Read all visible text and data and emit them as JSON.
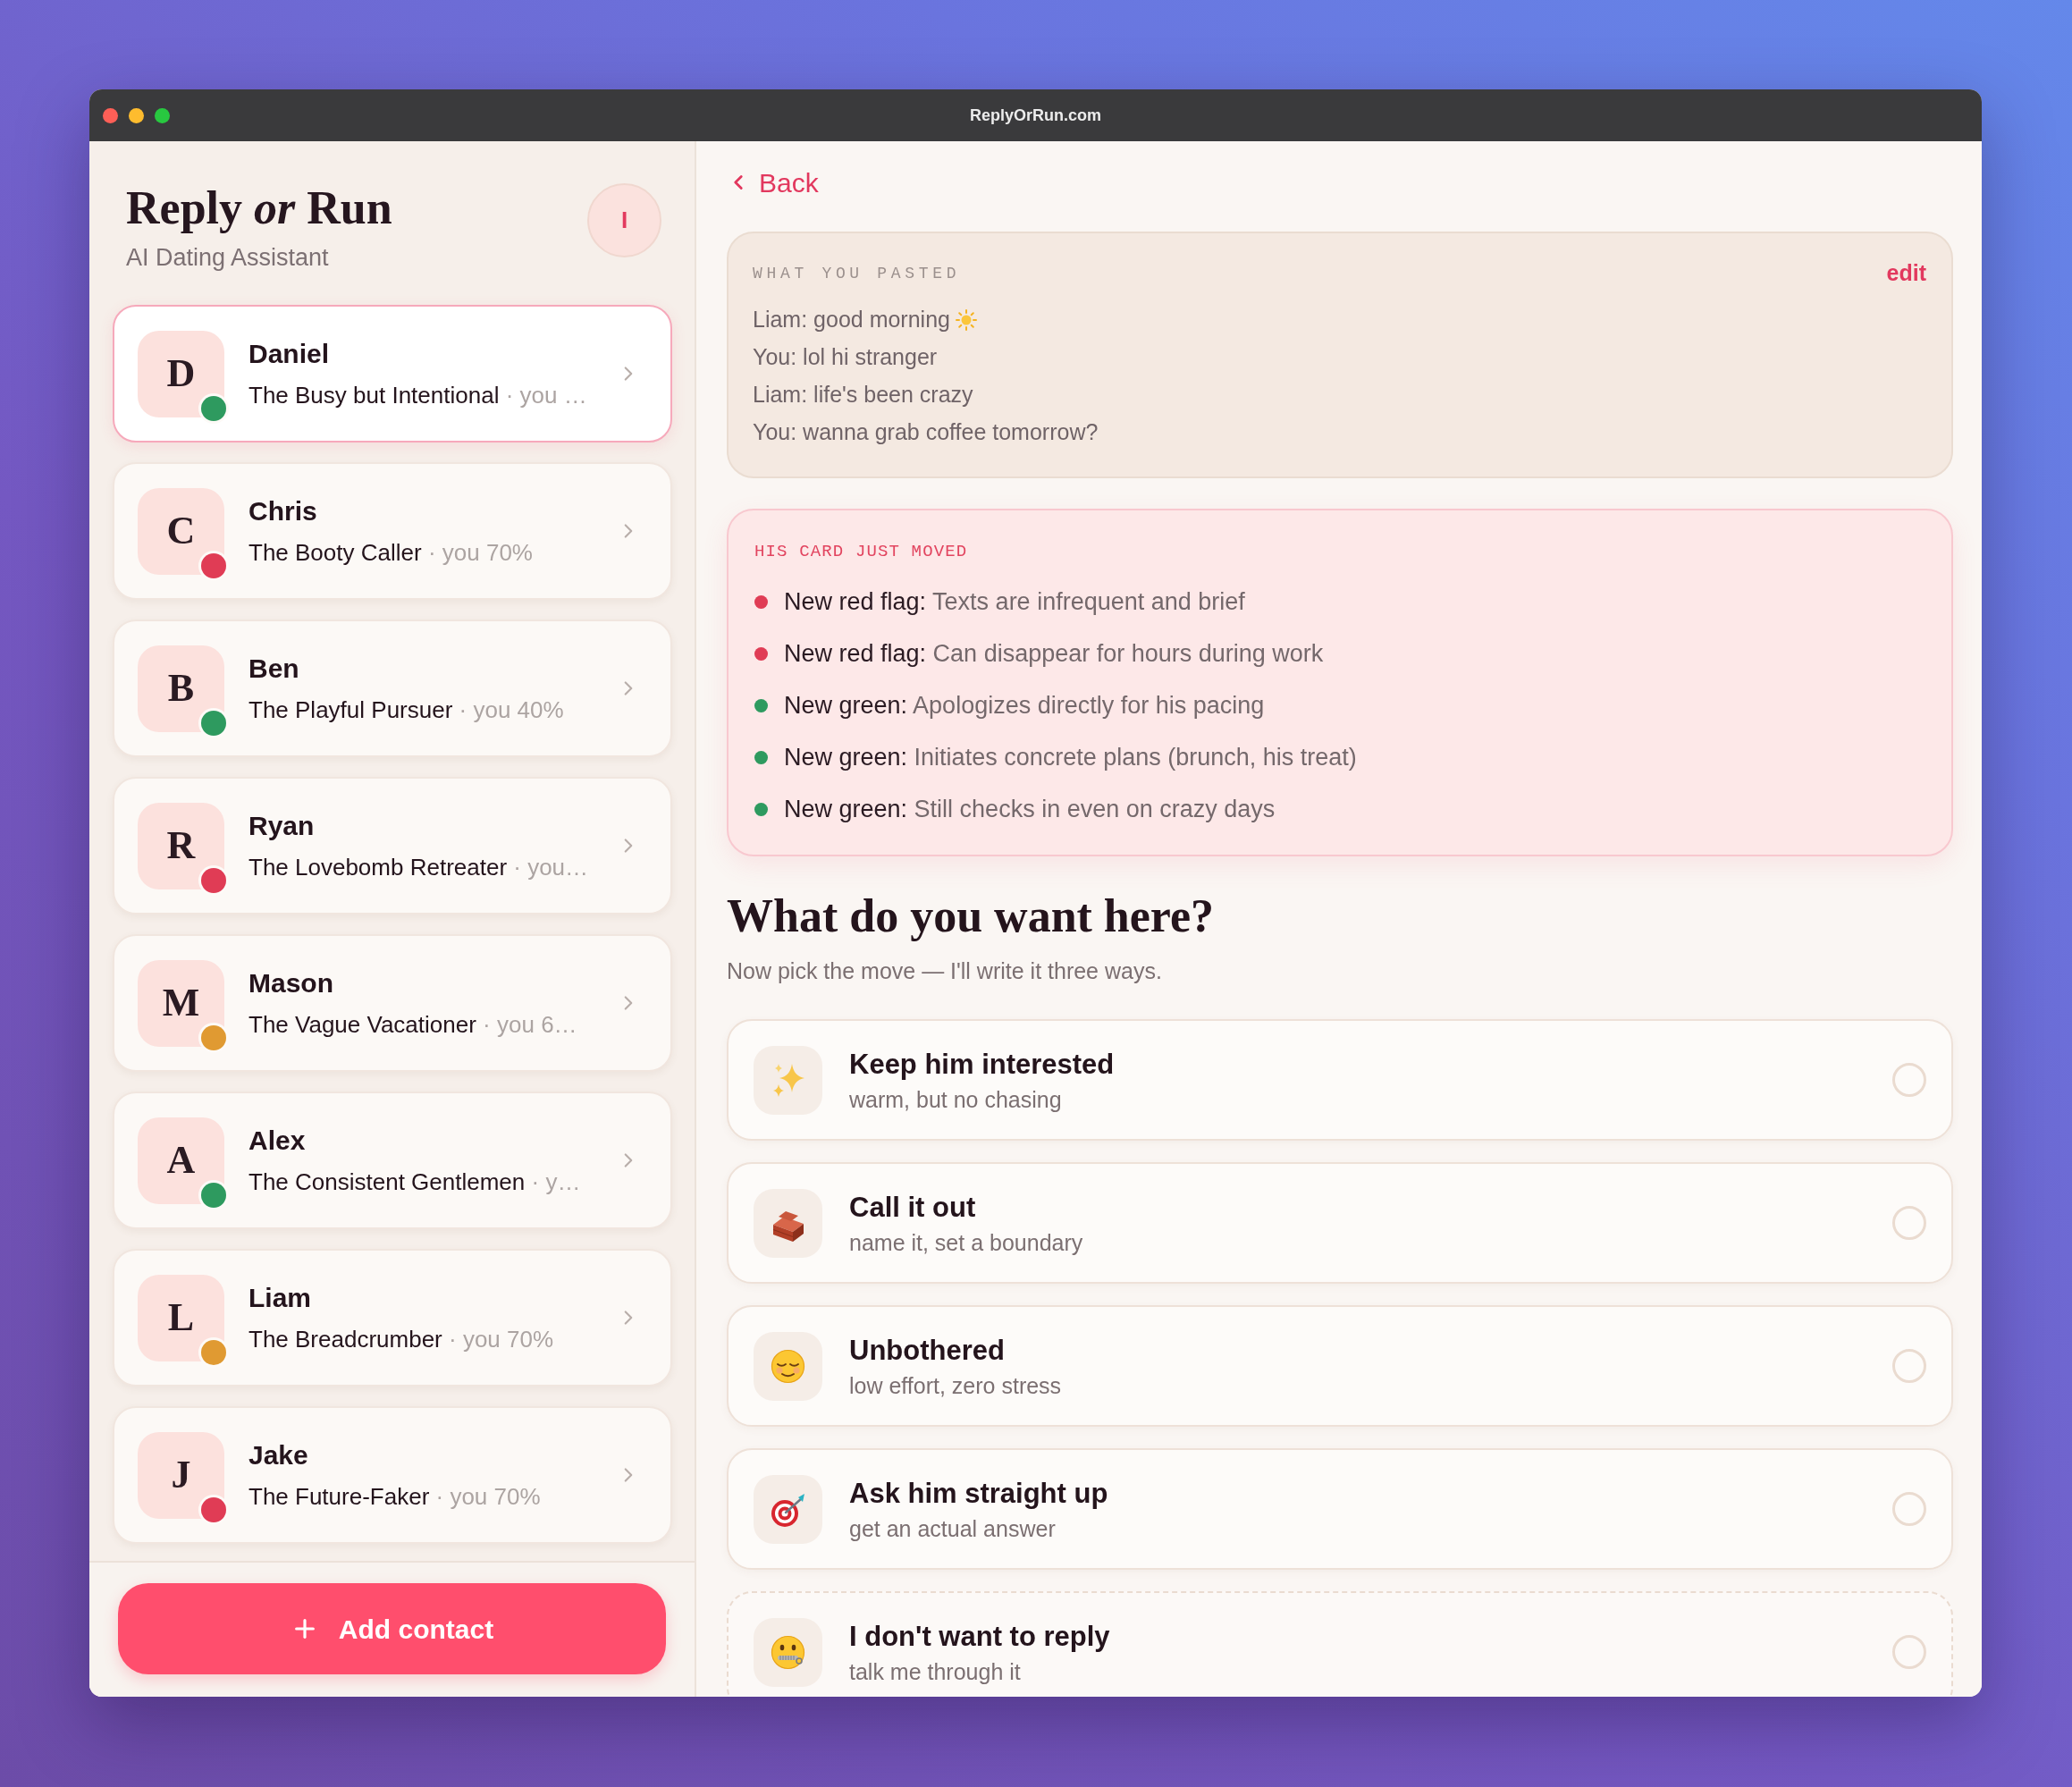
{
  "window": {
    "title": "ReplyOrRun.com"
  },
  "sidebar": {
    "app_title": "Reply *or* Run",
    "subtitle": "AI Dating Assistant",
    "profile_initial": "I",
    "contacts": [
      {
        "initial": "D",
        "name": "Daniel",
        "archetype": "The Busy but Intentional",
        "detail": "· you …",
        "color": "#2e9a5f",
        "selected": true
      },
      {
        "initial": "C",
        "name": "Chris",
        "archetype": "The Booty Caller",
        "detail": "· you 70%",
        "color": "#e03c55",
        "selected": false
      },
      {
        "initial": "B",
        "name": "Ben",
        "archetype": "The Playful Pursuer",
        "detail": "· you 40%",
        "color": "#2e9a5f",
        "selected": false
      },
      {
        "initial": "R",
        "name": "Ryan",
        "archetype": "The Lovebomb Retreater",
        "detail": "· you…",
        "color": "#e03c55",
        "selected": false
      },
      {
        "initial": "M",
        "name": "Mason",
        "archetype": "The Vague Vacationer",
        "detail": "· you 6…",
        "color": "#e09a32",
        "selected": false
      },
      {
        "initial": "A",
        "name": "Alex",
        "archetype": "The Consistent Gentlemen",
        "detail": "· y…",
        "color": "#2e9a5f",
        "selected": false
      },
      {
        "initial": "L",
        "name": "Liam",
        "archetype": "The Breadcrumber",
        "detail": "· you 70%",
        "color": "#e09a32",
        "selected": false
      },
      {
        "initial": "J",
        "name": "Jake",
        "archetype": "The Future-Faker",
        "detail": "· you 70%",
        "color": "#e03c55",
        "selected": false
      }
    ],
    "add_button": "Add contact"
  },
  "detail": {
    "back": "Back",
    "pasted": {
      "heading": "WHAT YOU PASTED",
      "edit": "edit",
      "lines": [
        {
          "text": "Liam: good morning",
          "kind": "sun"
        },
        {
          "text": "You: lol hi stranger",
          "kind": "plain"
        },
        {
          "text": "Liam: life's been crazy",
          "kind": "plain"
        },
        {
          "text": "You: wanna grab coffee tomorrow?",
          "kind": "plain"
        }
      ]
    },
    "changes": {
      "heading": "HIS CARD JUST MOVED",
      "items": [
        {
          "label": "New red flag:",
          "text": "Texts are infrequent and brief",
          "color": "#e03c55"
        },
        {
          "label": "New red flag:",
          "text": "Can disappear for hours during work",
          "color": "#e03c55"
        },
        {
          "label": "New green:",
          "text": "Apologizes directly for his pacing",
          "color": "#2e9a5f"
        },
        {
          "label": "New green:",
          "text": "Initiates concrete plans (brunch, his treat)",
          "color": "#2e9a5f"
        },
        {
          "label": "New green:",
          "text": "Still checks in even on crazy days",
          "color": "#2e9a5f"
        }
      ]
    },
    "question": "What do you want here?",
    "hint": "Now pick the move — I'll write it three ways.",
    "options": [
      {
        "kind": "sparkles",
        "title": "Keep him interested",
        "subtitle": "warm, but no chasing",
        "selected": false,
        "dashed": false
      },
      {
        "kind": "brick",
        "title": "Call it out",
        "subtitle": "name it, set a boundary",
        "selected": false,
        "dashed": false
      },
      {
        "kind": "relieved",
        "title": "Unbothered",
        "subtitle": "low effort, zero stress",
        "selected": false,
        "dashed": false
      },
      {
        "kind": "target",
        "title": "Ask him straight up",
        "subtitle": "get an actual answer",
        "selected": false,
        "dashed": false
      },
      {
        "kind": "zipper",
        "title": "I don't want to reply",
        "subtitle": "talk me through it",
        "selected": false,
        "dashed": true
      }
    ]
  }
}
